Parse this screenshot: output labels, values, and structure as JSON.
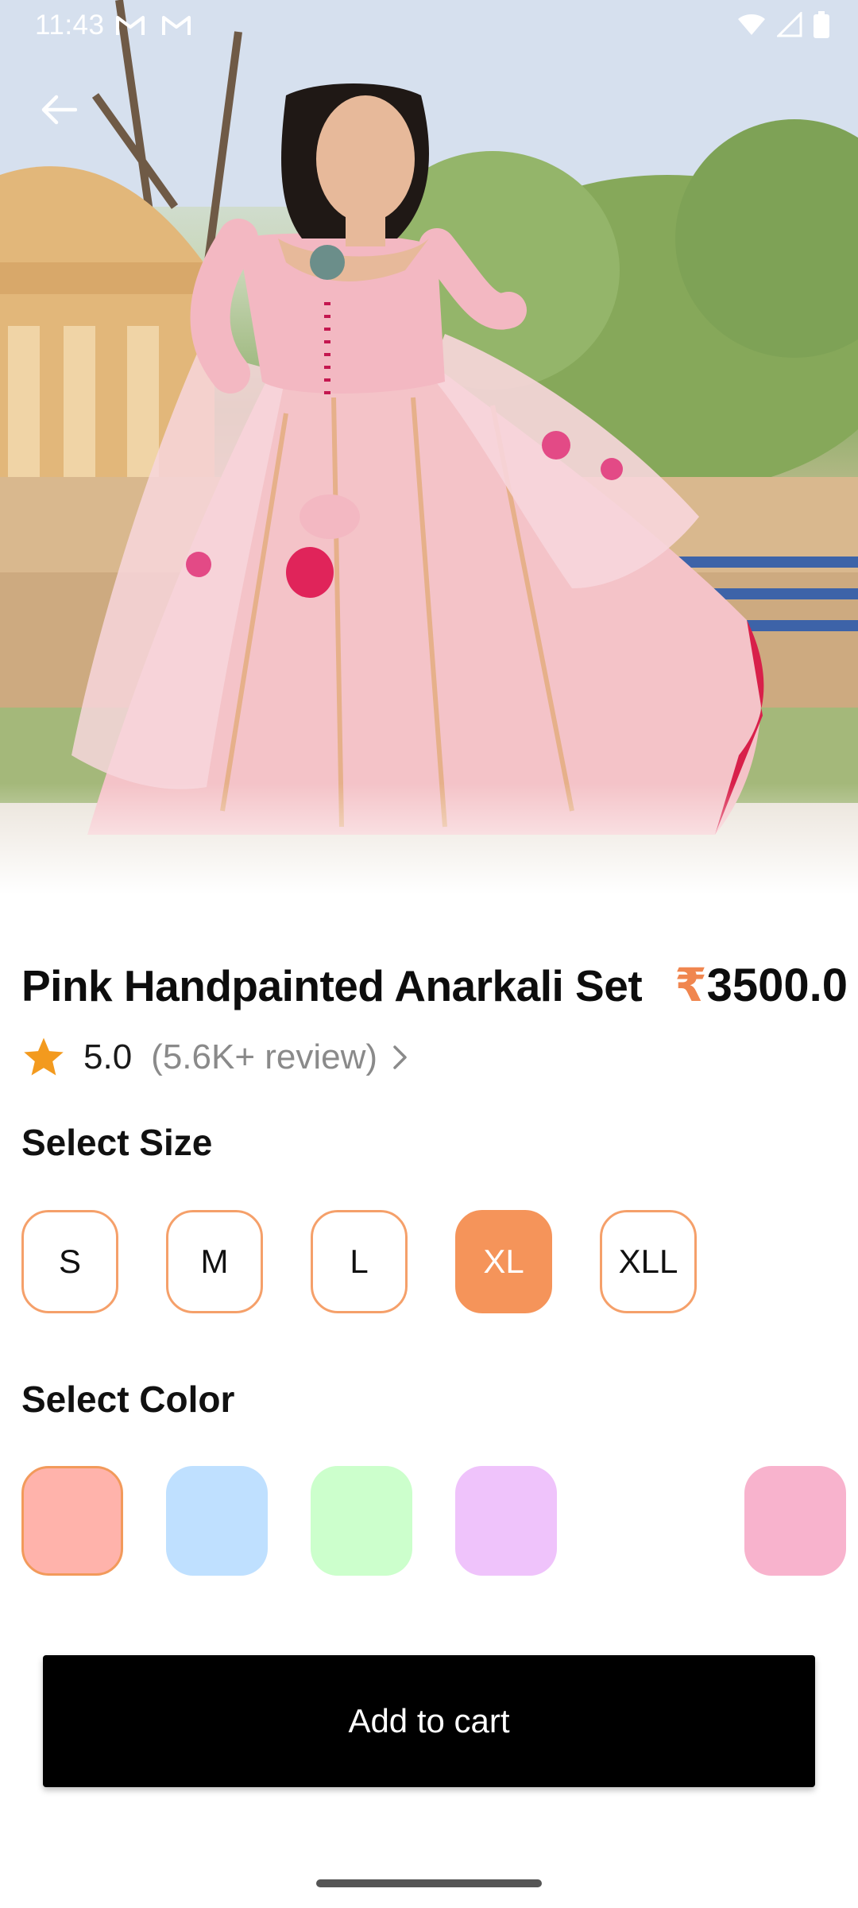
{
  "status_bar": {
    "time": "11:43",
    "notification_icons": [
      "gmail-icon",
      "gmail-icon"
    ],
    "system_icons": [
      "wifi-icon",
      "signal-icon",
      "battery-icon"
    ]
  },
  "navigation": {
    "back_icon": "arrow-left-icon"
  },
  "product": {
    "title": "Pink Handpainted Anarkali Set",
    "price_currency": "₹",
    "price_value": "3500.0",
    "rating_value": "5.0",
    "reviews_text": "(5.6K+ review)"
  },
  "sizes": {
    "label": "Select Size",
    "options": [
      "S",
      "M",
      "L",
      "XL",
      "XLL"
    ],
    "selected": "XL"
  },
  "colors": {
    "label": "Select Color",
    "swatches": [
      "#ffb3ab",
      "#bfe0ff",
      "#ccffcc",
      "#efc3fb",
      "#ffffff",
      "#f8b3cd"
    ],
    "selected_index": 0
  },
  "cart": {
    "button_label": "Add to cart"
  },
  "theme": {
    "accent": "#f5945a",
    "price_currency_color": "#f0864f",
    "star": "#f39a1e"
  }
}
